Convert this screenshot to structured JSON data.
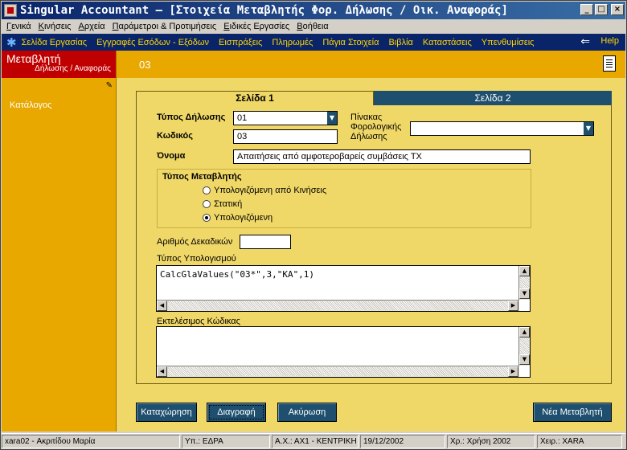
{
  "window": {
    "title": "Singular Accountant – [Στοιχεία Μεταβλητής Φορ. Δήλωσης / Οικ. Αναφοράς]",
    "btn_min": "_",
    "btn_max": "□",
    "btn_close": "×"
  },
  "menu": [
    "Γενικά",
    "Κινήσεις",
    "Αρχεία",
    "Παράμετροι & Προτιμήσεις",
    "Ειδικές Εργασίες",
    "Βοήθεια"
  ],
  "nav": {
    "items": [
      "Σελίδα Εργασίας",
      "Εγγραφές Εσόδων - Εξόδων",
      "Εισπράξεις",
      "Πληρωμές",
      "Πάγια Στοιχεία",
      "Βιβλία",
      "Καταστάσεις",
      "Υπενθυμίσεις"
    ],
    "help": "Help"
  },
  "left": {
    "title": "Μεταβλητή",
    "subtitle": "Δήλωσης / Αναφοράς",
    "catalog": "Κατάλογος"
  },
  "header": {
    "code": "03"
  },
  "tabs": {
    "page1": "Σελίδα 1",
    "page2": "Σελίδα 2"
  },
  "form": {
    "type_label": "Τύπος Δήλωσης",
    "type_value": "01",
    "code_label": "Κωδικός",
    "code_value": "03",
    "name_label": "Όνομα",
    "name_value": "Απαιτήσεις από αμφοτεροβαρείς συμβάσεις ΤΧ",
    "table_label_1": "Πίνακας",
    "table_label_2": "Φορολογικής",
    "table_label_3": "Δήλωσης",
    "table_value": "",
    "var_type_label": "Τύπος Μεταβλητής",
    "radio_1": "Υπολογιζόμενη από Κινήσεις",
    "radio_2": "Στατική",
    "radio_3": "Υπολογιζόμενη",
    "radio_selected": 3,
    "decimals_label": "Αριθμός Δεκαδικών",
    "decimals_value": "",
    "calc_label": "Τύπος Υπολογισμού",
    "calc_value": "CalcGlaValues(\"03*\",3,\"ΚΑ\",1)",
    "exec_label": "Εκτελέσιμος Κώδικας",
    "exec_value": ""
  },
  "buttons": {
    "save": "Καταχώρηση",
    "delete": "Διαγραφή",
    "cancel": "Ακύρωση",
    "new": "Νέα Μεταβλητή"
  },
  "status": {
    "user": "xara02 - Ακριτίδου Μαρία",
    "branch": "Υπ.: ΕΔΡΑ",
    "tax_office": "Α.Χ.: ΑΧ1 - ΚΕΝΤΡΙΚΗ",
    "date": "19/12/2002",
    "fiscal_year": "Χρ.: Χρήση 2002",
    "operator": "Χειρ.: XARA"
  },
  "colors": {
    "accent": "#e8a800",
    "nav_bg": "#0a246a",
    "button_bg": "#1e4f6e",
    "header_red": "#c00000"
  }
}
